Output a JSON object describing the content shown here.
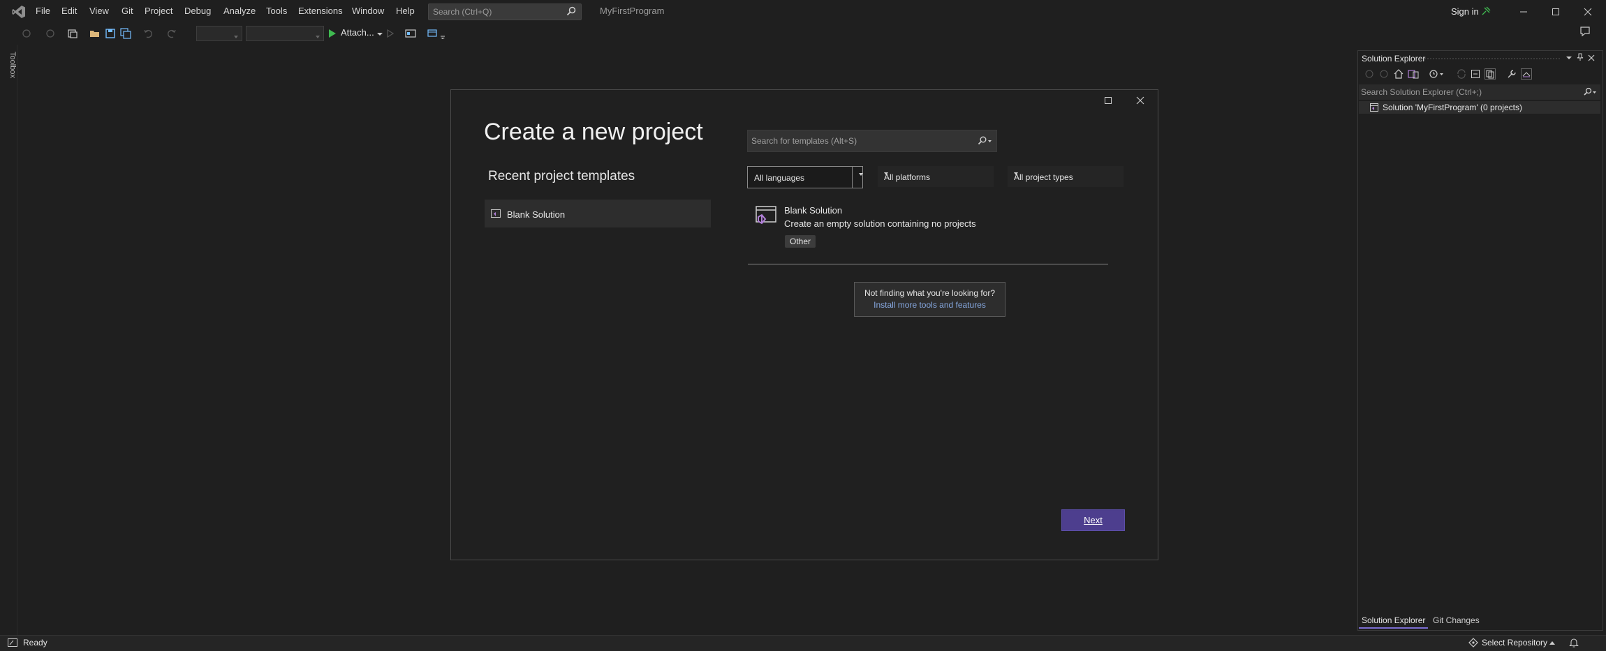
{
  "menu": {
    "items": [
      "File",
      "Edit",
      "View",
      "Git",
      "Project",
      "Debug",
      "Analyze",
      "Tools",
      "Extensions",
      "Window",
      "Help"
    ]
  },
  "search": {
    "placeholder": "Search (Ctrl+Q)"
  },
  "solution_name": "MyFirstProgram",
  "account": {
    "sign_in": "Sign in"
  },
  "toolbar": {
    "attach_label": "Attach..."
  },
  "toolbox": {
    "label": "Toolbox"
  },
  "dialog": {
    "title": "Create a new project",
    "recent_title": "Recent project templates",
    "recent_items": [
      "Blank Solution"
    ],
    "template_search_placeholder": "Search for templates (Alt+S)",
    "filters": {
      "language": "All languages",
      "platform": "All platforms",
      "project_type": "All project types"
    },
    "templates": [
      {
        "name": "Blank Solution",
        "description": "Create an empty solution containing no projects",
        "tag": "Other"
      }
    ],
    "not_finding": "Not finding what you're looking for?",
    "install_link": "Install more tools and features",
    "next_label": "Next"
  },
  "solution_explorer": {
    "title": "Solution Explorer",
    "search_placeholder": "Search Solution Explorer (Ctrl+;)",
    "root": "Solution 'MyFirstProgram' (0 projects)",
    "tabs": [
      "Solution Explorer",
      "Git Changes"
    ]
  },
  "status": {
    "ready": "Ready",
    "repository": "Select Repository"
  },
  "colors": {
    "accent": "#4d3e8e",
    "link": "#86a8e0",
    "background": "#1f1f1f"
  }
}
